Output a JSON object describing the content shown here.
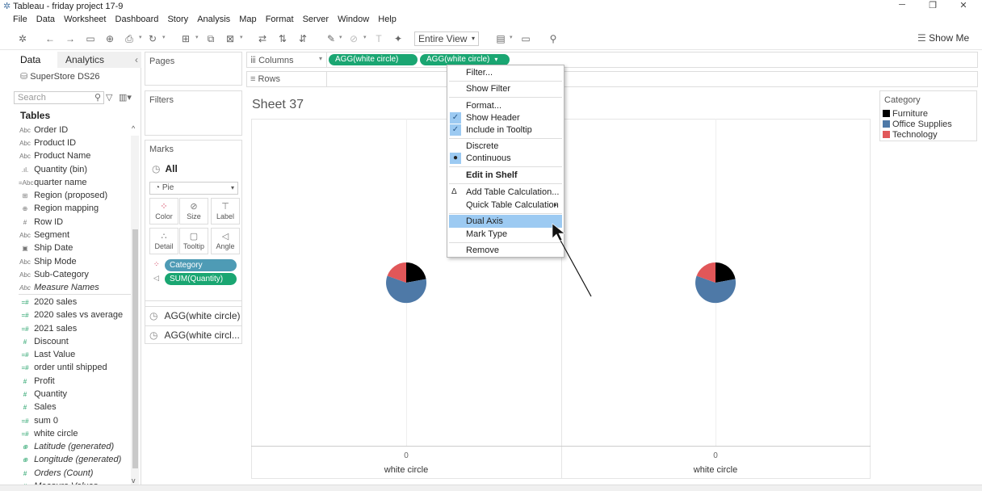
{
  "window": {
    "title": "Tableau - friday project 17-9"
  },
  "menu": [
    "File",
    "Data",
    "Worksheet",
    "Dashboard",
    "Story",
    "Analysis",
    "Map",
    "Format",
    "Server",
    "Window",
    "Help"
  ],
  "toolbar": {
    "fit": "Entire View",
    "show_me": "Show Me"
  },
  "left_pane": {
    "tab_data": "Data",
    "tab_analytics": "Analytics",
    "datasource": "SuperStore DS26",
    "search_placeholder": "Search",
    "tables_header": "Tables",
    "fields": [
      {
        "icon": "Abc",
        "label": "Order ID"
      },
      {
        "icon": "Abc",
        "label": "Product ID"
      },
      {
        "icon": "Abc",
        "label": "Product Name"
      },
      {
        "icon": ".ıl.",
        "label": "Quantity (bin)"
      },
      {
        "icon": "=Abc",
        "label": "quarter name"
      },
      {
        "icon": "⊞",
        "label": "Region (proposed)"
      },
      {
        "icon": "⊕",
        "label": "Region mapping"
      },
      {
        "icon": "#",
        "label": "Row ID"
      },
      {
        "icon": "Abc",
        "label": "Segment"
      },
      {
        "icon": "▣",
        "label": "Ship Date"
      },
      {
        "icon": "Abc",
        "label": "Ship Mode"
      },
      {
        "icon": "Abc",
        "label": "Sub-Category"
      },
      {
        "icon": "Abc",
        "label": "Measure Names"
      },
      {
        "icon": "=#",
        "label": "2020 sales"
      },
      {
        "icon": "=#",
        "label": "2020 sales vs average"
      },
      {
        "icon": "=#",
        "label": "2021 sales"
      },
      {
        "icon": "#",
        "label": "Discount"
      },
      {
        "icon": "=#",
        "label": "Last Value"
      },
      {
        "icon": "=#",
        "label": "order until shipped"
      },
      {
        "icon": "#",
        "label": "Profit"
      },
      {
        "icon": "#",
        "label": "Quantity"
      },
      {
        "icon": "#",
        "label": "Sales"
      },
      {
        "icon": "=#",
        "label": "sum 0"
      },
      {
        "icon": "=#",
        "label": "white circle"
      },
      {
        "icon": "⊕",
        "label": "Latitude (generated)"
      },
      {
        "icon": "⊕",
        "label": "Longitude (generated)"
      },
      {
        "icon": "#",
        "label": "Orders (Count)"
      },
      {
        "icon": "#",
        "label": "Measure Values"
      }
    ]
  },
  "shelves": {
    "pages": "Pages",
    "filters": "Filters",
    "marks": "Marks",
    "marks_all": "All",
    "mark_type": "Pie",
    "mark_buttons": [
      "Color",
      "Size",
      "Label",
      "Detail",
      "Tooltip",
      "Angle"
    ],
    "pill_category": "Category",
    "pill_quantity": "SUM(Quantity)",
    "agg1": "AGG(white circle)",
    "agg2": "AGG(white circl...",
    "columns": "Columns",
    "rows": "Rows",
    "col_pill_1": "AGG(white circle)",
    "col_pill_2": "AGG(white circle)"
  },
  "view": {
    "sheet_title": "Sheet 37",
    "axis_tick": "0",
    "axis_title": "white circle"
  },
  "legend": {
    "title": "Category",
    "items": [
      {
        "label": "Furniture",
        "color": "#000000"
      },
      {
        "label": "Office Supplies",
        "color": "#4e79a7"
      },
      {
        "label": "Technology",
        "color": "#e15759"
      }
    ]
  },
  "context_menu": {
    "filter": "Filter...",
    "show_filter": "Show Filter",
    "format": "Format...",
    "show_header": "Show Header",
    "include_tooltip": "Include in Tooltip",
    "discrete": "Discrete",
    "continuous": "Continuous",
    "edit_in_shelf": "Edit in Shelf",
    "add_table_calc": "Add Table Calculation...",
    "quick_table_calc": "Quick Table Calculation",
    "dual_axis": "Dual Axis",
    "mark_type": "Mark Type",
    "remove": "Remove"
  },
  "colors": {
    "accent_green": "#1aa672",
    "pill_blue": "#4e9bb5",
    "highlight": "#9ccaf2"
  }
}
